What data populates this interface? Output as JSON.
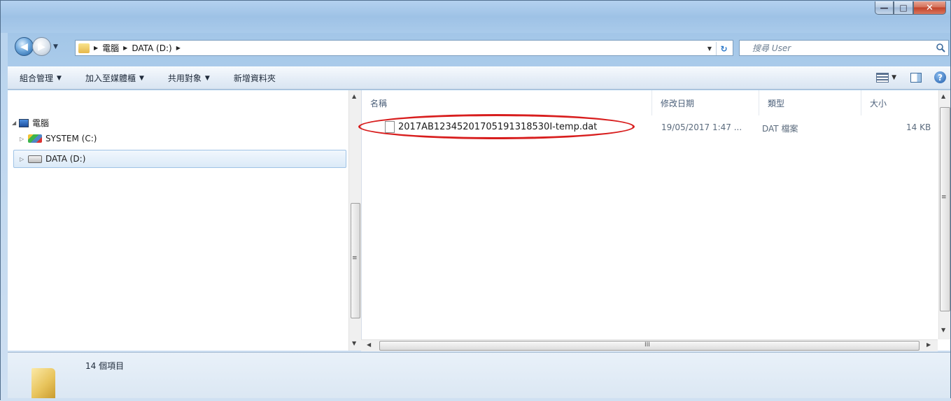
{
  "window": {
    "minimize_label": "—",
    "maximize_label": "□",
    "close_label": "✕"
  },
  "nav": {
    "back_glyph": "◀",
    "forward_glyph": "▶",
    "history_glyph": "▼"
  },
  "address": {
    "crumbs": [
      "電腦",
      "DATA (D:)"
    ],
    "separator": "▶",
    "dropdown_glyph": "▼",
    "refresh_glyph": "↻"
  },
  "search": {
    "placeholder": "搜尋 User"
  },
  "commands": {
    "organize": "組合管理",
    "add_to_library": "加入至媒體櫃",
    "share_with": "共用對象",
    "new_folder": "新增資料夾",
    "arrow": "▼",
    "help_glyph": "?"
  },
  "tree": {
    "computer": "電腦",
    "drives": [
      {
        "label": "SYSTEM (C:)"
      },
      {
        "label": "DATA (D:)"
      }
    ],
    "expanded_glyph": "◢",
    "collapsed_glyph": "▷"
  },
  "columns": {
    "name": "名稱",
    "date_modified": "修改日期",
    "type": "類型",
    "size": "大小"
  },
  "files": [
    {
      "name": "2017AB12345201705191318530I-temp.dat",
      "date_modified": "19/05/2017 1:47 ...",
      "type": "DAT 檔案",
      "size": "14 KB"
    }
  ],
  "scroll": {
    "up": "▲",
    "down": "▼",
    "left": "◀",
    "right": "▶",
    "grip_v": "≡",
    "grip_h": "III"
  },
  "details": {
    "item_count": "14 個項目"
  },
  "colors": {
    "highlight_ellipse": "#d81e1e",
    "selection_border": "#9fc3e6"
  }
}
